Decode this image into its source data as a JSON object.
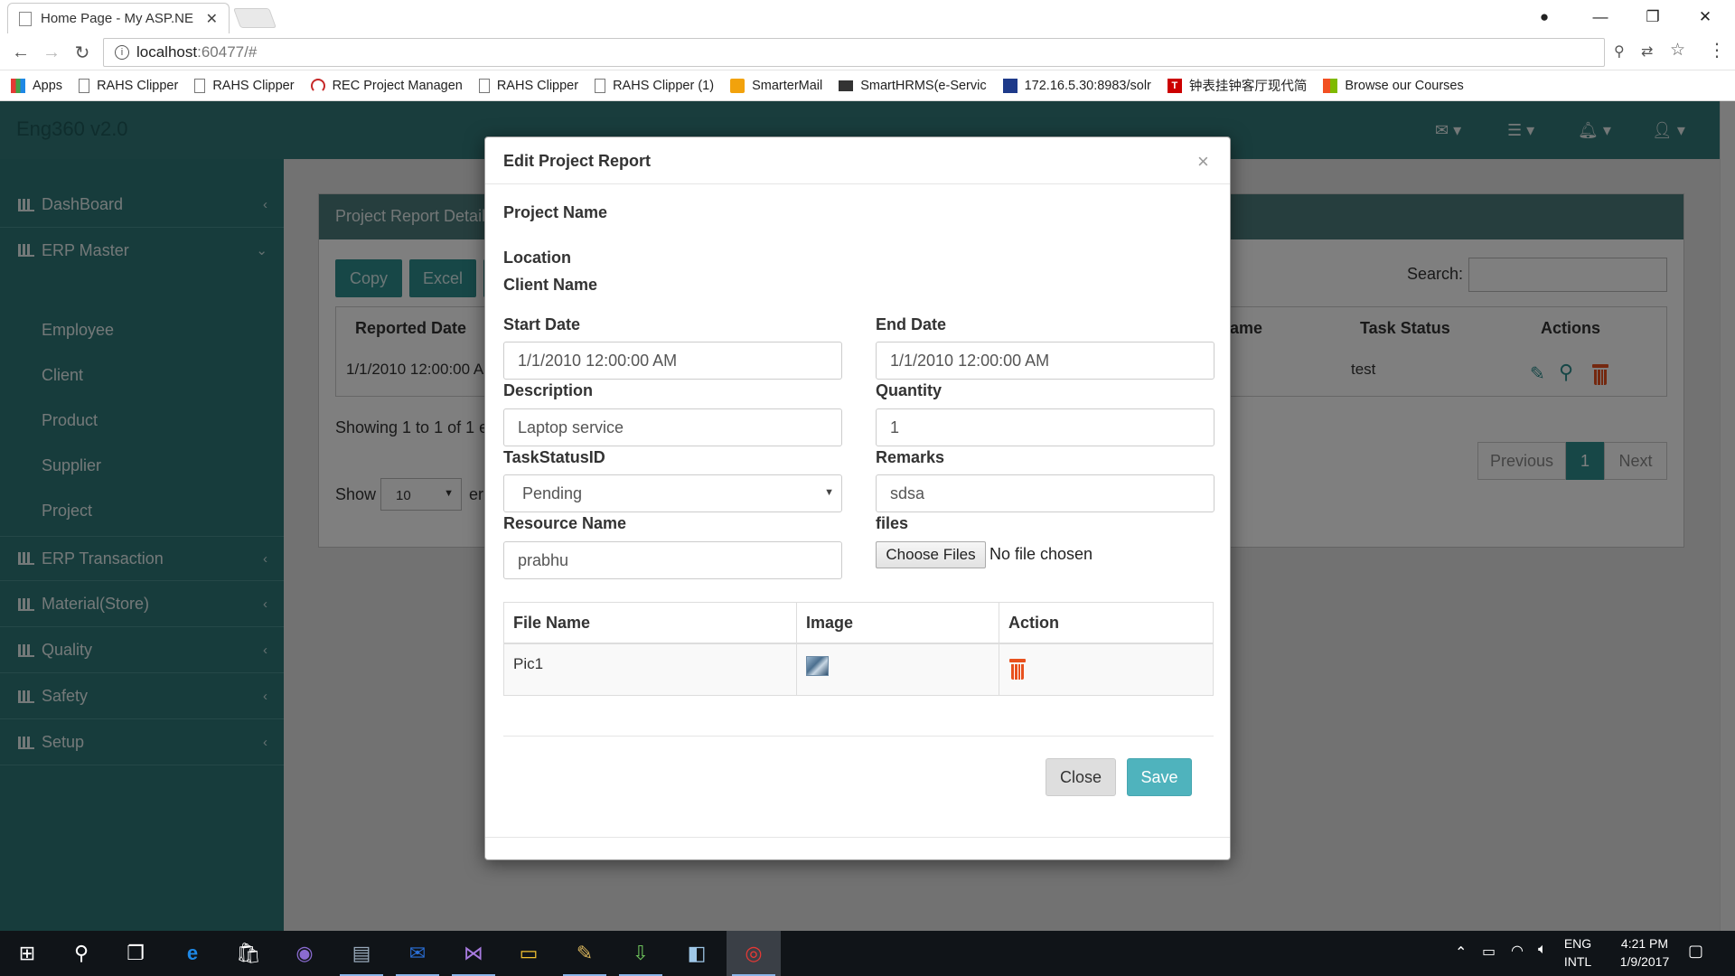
{
  "browser": {
    "tab_title": "Home Page - My ASP.NE",
    "url_host": "localhost",
    "url_path": ":60477/#",
    "bookmarks": [
      {
        "label": "Apps",
        "icon": "grid"
      },
      {
        "label": "RAHS Clipper",
        "icon": "page"
      },
      {
        "label": "RAHS Clipper",
        "icon": "page"
      },
      {
        "label": "REC Project Managen",
        "icon": "rec"
      },
      {
        "label": "RAHS Clipper",
        "icon": "page"
      },
      {
        "label": "RAHS Clipper (1)",
        "icon": "page"
      },
      {
        "label": "SmarterMail",
        "icon": "mail"
      },
      {
        "label": "SmartHRMS(e-Servic",
        "icon": "laptop"
      },
      {
        "label": "172.16.5.30:8983/solr",
        "icon": "solr"
      },
      {
        "label": "钟表挂钟客厅现代简",
        "icon": "t"
      },
      {
        "label": "Browse our Courses",
        "icon": "ms"
      }
    ]
  },
  "app": {
    "brand": "Eng360 v2.0",
    "sidebar": {
      "items": [
        {
          "label": "DashBoard"
        },
        {
          "label": "ERP Master"
        },
        {
          "label": "ERP Transaction"
        },
        {
          "label": "Material(Store)"
        },
        {
          "label": "Quality"
        },
        {
          "label": "Safety"
        },
        {
          "label": "Setup"
        }
      ],
      "subitems": [
        "Employee",
        "Client",
        "Product",
        "Supplier",
        "Project"
      ]
    },
    "panel": {
      "title": "Project Report Details",
      "buttons": [
        "Copy",
        "Excel"
      ],
      "search_label": "Search:",
      "columns": [
        "Reported Date",
        "ame",
        "Task Status",
        "Actions"
      ],
      "row": {
        "reported_date": "1/1/2010 12:00:00 A",
        "task_status": "test"
      },
      "showing": "Showing 1 to 1 of 1 e",
      "show_label": "Show",
      "show_value": "10",
      "show_suffix": "er",
      "pagination": {
        "previous": "Previous",
        "current": "1",
        "next": "Next"
      }
    }
  },
  "modal": {
    "title": "Edit Project Report",
    "close_x": "×",
    "labels": {
      "project_name": "Project Name",
      "location": "Location",
      "client_name": "Client Name",
      "start_date": "Start Date",
      "end_date": "End Date",
      "description": "Description",
      "quantity": "Quantity",
      "task_status": "TaskStatusID",
      "remarks": "Remarks",
      "resource_name": "Resource Name",
      "files": "files"
    },
    "values": {
      "start_date": "1/1/2010 12:00:00 AM",
      "end_date": "1/1/2010 12:00:00 AM",
      "description": "Laptop service",
      "quantity": "1",
      "task_status": "Pending",
      "remarks": "sdsa",
      "resource_name": "prabhu"
    },
    "file_input": {
      "button": "Choose Files",
      "status": "No file chosen"
    },
    "file_table": {
      "headers": [
        "File Name",
        "Image",
        "Action"
      ],
      "rows": [
        {
          "file_name": "Pic1"
        }
      ]
    },
    "buttons": {
      "close": "Close",
      "save": "Save"
    }
  },
  "taskbar": {
    "lang_top": "ENG",
    "lang_bottom": "INTL",
    "time": "4:21 PM",
    "date": "1/9/2017"
  },
  "colors": {
    "header": "#337b7b",
    "sidebar": "#2f7878",
    "save_button": "#4fb3bd",
    "trash_icon": "#e8511e"
  }
}
